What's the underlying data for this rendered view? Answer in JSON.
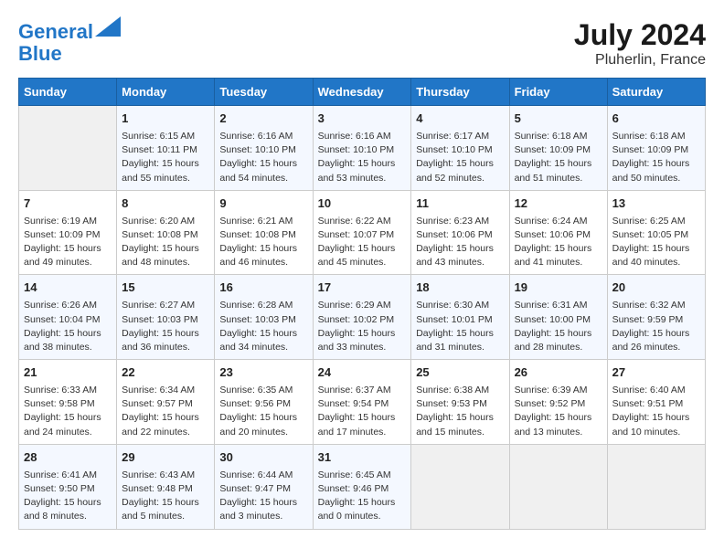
{
  "header": {
    "logo_line1": "General",
    "logo_line2": "Blue",
    "month_year": "July 2024",
    "location": "Pluherlin, France"
  },
  "days_of_week": [
    "Sunday",
    "Monday",
    "Tuesday",
    "Wednesday",
    "Thursday",
    "Friday",
    "Saturday"
  ],
  "weeks": [
    [
      {
        "day": "",
        "info": ""
      },
      {
        "day": "1",
        "info": "Sunrise: 6:15 AM\nSunset: 10:11 PM\nDaylight: 15 hours\nand 55 minutes."
      },
      {
        "day": "2",
        "info": "Sunrise: 6:16 AM\nSunset: 10:10 PM\nDaylight: 15 hours\nand 54 minutes."
      },
      {
        "day": "3",
        "info": "Sunrise: 6:16 AM\nSunset: 10:10 PM\nDaylight: 15 hours\nand 53 minutes."
      },
      {
        "day": "4",
        "info": "Sunrise: 6:17 AM\nSunset: 10:10 PM\nDaylight: 15 hours\nand 52 minutes."
      },
      {
        "day": "5",
        "info": "Sunrise: 6:18 AM\nSunset: 10:09 PM\nDaylight: 15 hours\nand 51 minutes."
      },
      {
        "day": "6",
        "info": "Sunrise: 6:18 AM\nSunset: 10:09 PM\nDaylight: 15 hours\nand 50 minutes."
      }
    ],
    [
      {
        "day": "7",
        "info": "Sunrise: 6:19 AM\nSunset: 10:09 PM\nDaylight: 15 hours\nand 49 minutes."
      },
      {
        "day": "8",
        "info": "Sunrise: 6:20 AM\nSunset: 10:08 PM\nDaylight: 15 hours\nand 48 minutes."
      },
      {
        "day": "9",
        "info": "Sunrise: 6:21 AM\nSunset: 10:08 PM\nDaylight: 15 hours\nand 46 minutes."
      },
      {
        "day": "10",
        "info": "Sunrise: 6:22 AM\nSunset: 10:07 PM\nDaylight: 15 hours\nand 45 minutes."
      },
      {
        "day": "11",
        "info": "Sunrise: 6:23 AM\nSunset: 10:06 PM\nDaylight: 15 hours\nand 43 minutes."
      },
      {
        "day": "12",
        "info": "Sunrise: 6:24 AM\nSunset: 10:06 PM\nDaylight: 15 hours\nand 41 minutes."
      },
      {
        "day": "13",
        "info": "Sunrise: 6:25 AM\nSunset: 10:05 PM\nDaylight: 15 hours\nand 40 minutes."
      }
    ],
    [
      {
        "day": "14",
        "info": "Sunrise: 6:26 AM\nSunset: 10:04 PM\nDaylight: 15 hours\nand 38 minutes."
      },
      {
        "day": "15",
        "info": "Sunrise: 6:27 AM\nSunset: 10:03 PM\nDaylight: 15 hours\nand 36 minutes."
      },
      {
        "day": "16",
        "info": "Sunrise: 6:28 AM\nSunset: 10:03 PM\nDaylight: 15 hours\nand 34 minutes."
      },
      {
        "day": "17",
        "info": "Sunrise: 6:29 AM\nSunset: 10:02 PM\nDaylight: 15 hours\nand 33 minutes."
      },
      {
        "day": "18",
        "info": "Sunrise: 6:30 AM\nSunset: 10:01 PM\nDaylight: 15 hours\nand 31 minutes."
      },
      {
        "day": "19",
        "info": "Sunrise: 6:31 AM\nSunset: 10:00 PM\nDaylight: 15 hours\nand 28 minutes."
      },
      {
        "day": "20",
        "info": "Sunrise: 6:32 AM\nSunset: 9:59 PM\nDaylight: 15 hours\nand 26 minutes."
      }
    ],
    [
      {
        "day": "21",
        "info": "Sunrise: 6:33 AM\nSunset: 9:58 PM\nDaylight: 15 hours\nand 24 minutes."
      },
      {
        "day": "22",
        "info": "Sunrise: 6:34 AM\nSunset: 9:57 PM\nDaylight: 15 hours\nand 22 minutes."
      },
      {
        "day": "23",
        "info": "Sunrise: 6:35 AM\nSunset: 9:56 PM\nDaylight: 15 hours\nand 20 minutes."
      },
      {
        "day": "24",
        "info": "Sunrise: 6:37 AM\nSunset: 9:54 PM\nDaylight: 15 hours\nand 17 minutes."
      },
      {
        "day": "25",
        "info": "Sunrise: 6:38 AM\nSunset: 9:53 PM\nDaylight: 15 hours\nand 15 minutes."
      },
      {
        "day": "26",
        "info": "Sunrise: 6:39 AM\nSunset: 9:52 PM\nDaylight: 15 hours\nand 13 minutes."
      },
      {
        "day": "27",
        "info": "Sunrise: 6:40 AM\nSunset: 9:51 PM\nDaylight: 15 hours\nand 10 minutes."
      }
    ],
    [
      {
        "day": "28",
        "info": "Sunrise: 6:41 AM\nSunset: 9:50 PM\nDaylight: 15 hours\nand 8 minutes."
      },
      {
        "day": "29",
        "info": "Sunrise: 6:43 AM\nSunset: 9:48 PM\nDaylight: 15 hours\nand 5 minutes."
      },
      {
        "day": "30",
        "info": "Sunrise: 6:44 AM\nSunset: 9:47 PM\nDaylight: 15 hours\nand 3 minutes."
      },
      {
        "day": "31",
        "info": "Sunrise: 6:45 AM\nSunset: 9:46 PM\nDaylight: 15 hours\nand 0 minutes."
      },
      {
        "day": "",
        "info": ""
      },
      {
        "day": "",
        "info": ""
      },
      {
        "day": "",
        "info": ""
      }
    ]
  ]
}
